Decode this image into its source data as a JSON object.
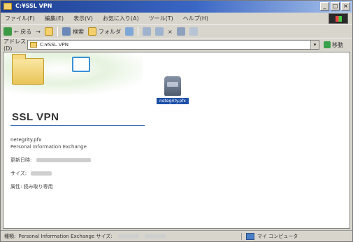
{
  "window": {
    "title": "C:¥SSL VPN",
    "minimize": "_",
    "maximize": "□",
    "close": "×"
  },
  "menu": {
    "items": [
      "ファイル(F)",
      "編集(E)",
      "表示(V)",
      "お気に入り(A)",
      "ツール(T)",
      "ヘルプ(H)"
    ]
  },
  "toolbar": {
    "back": "← 戻る",
    "forward": "→",
    "up": "",
    "search": "検索",
    "folders": "フォルダ",
    "history": "",
    "move": "",
    "copy": "",
    "delete": "×",
    "undo": "",
    "views": ""
  },
  "address": {
    "label": "アドレス(D)",
    "value": "C:¥SSL VPN",
    "go": "移動"
  },
  "panel": {
    "title": "SSL VPN",
    "file_name": "netegrity.pfx",
    "file_type": "Personal Information Exchange",
    "updated_label": "更新日時:",
    "size_label": "サイズ:",
    "attributes_label": "属性:",
    "attributes_value": "読み取り専用"
  },
  "file": {
    "label": "netegrity.pfx"
  },
  "status": {
    "left_prefix": "種類:",
    "left_text": "Personal Information Exchange サイズ:",
    "right_text": "マイ コンピュータ"
  }
}
